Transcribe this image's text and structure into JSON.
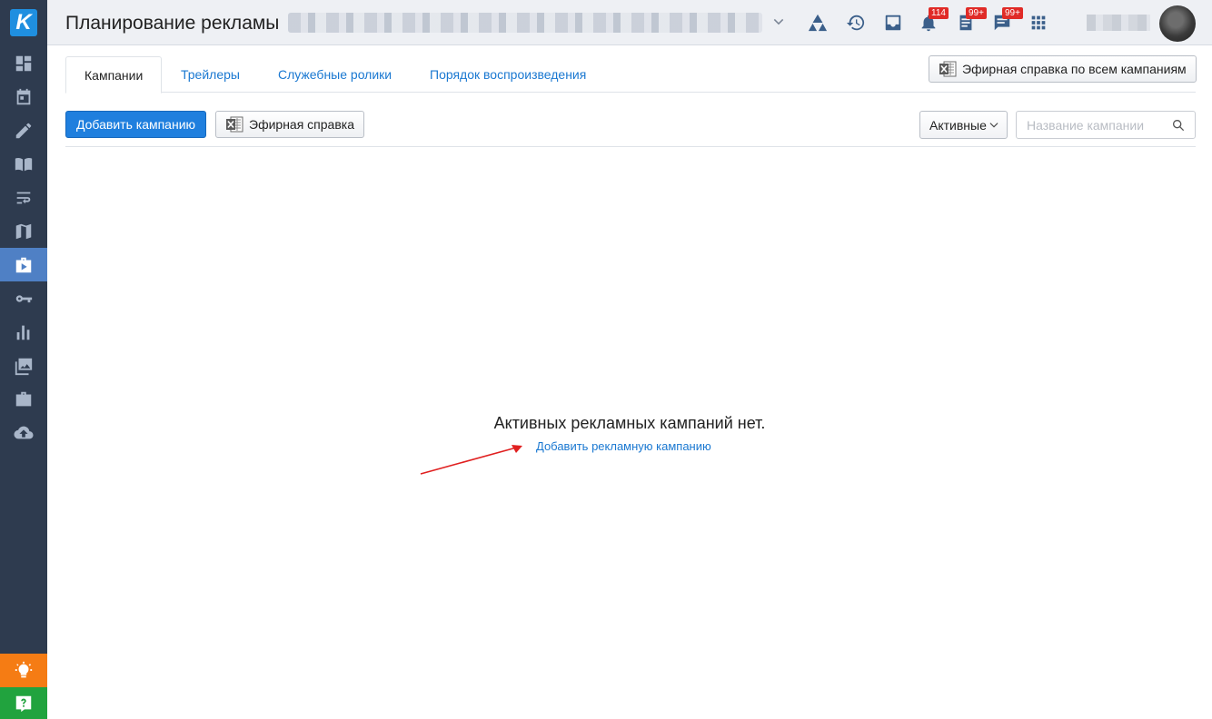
{
  "header": {
    "title": "Планирование рекламы",
    "notifications_badge": "114",
    "tasks_badge": "99+",
    "messages_badge": "99+"
  },
  "tabs": [
    {
      "label": "Кампании"
    },
    {
      "label": "Трейлеры"
    },
    {
      "label": "Служебные ролики"
    },
    {
      "label": "Порядок воспроизведения"
    }
  ],
  "toolbar": {
    "all_campaigns_report": "Эфирная справка по всем кампаниям",
    "add_campaign": "Добавить кампанию",
    "air_report": "Эфирная справка",
    "filter_value": "Активные",
    "search_placeholder": "Название кампании"
  },
  "empty_state": {
    "message": "Активных рекламных кампаний нет.",
    "link": "Добавить рекламную кампанию"
  },
  "colors": {
    "sidebar": "#2e3b4f",
    "sidebar_active": "#4f80c5",
    "primary": "#1f7fde",
    "link": "#1a78d1",
    "badge": "#e02b27",
    "bulb": "#f57c14",
    "help": "#21a33e",
    "arrow": "#e02020"
  },
  "icons": {
    "sidebar": [
      "dashboard-icon",
      "calendar-icon",
      "pencil-icon",
      "book-icon",
      "wrap-text-icon",
      "map-icon",
      "advertising-icon",
      "key-icon",
      "bar-chart-icon",
      "gallery-icon",
      "briefcase-icon",
      "cloud-upload-icon"
    ],
    "header": [
      "chevron-down-icon",
      "triangles-icon",
      "history-icon",
      "inbox-icon",
      "bell-icon",
      "tasks-icon",
      "chat-icon",
      "apps-grid-icon"
    ]
  }
}
